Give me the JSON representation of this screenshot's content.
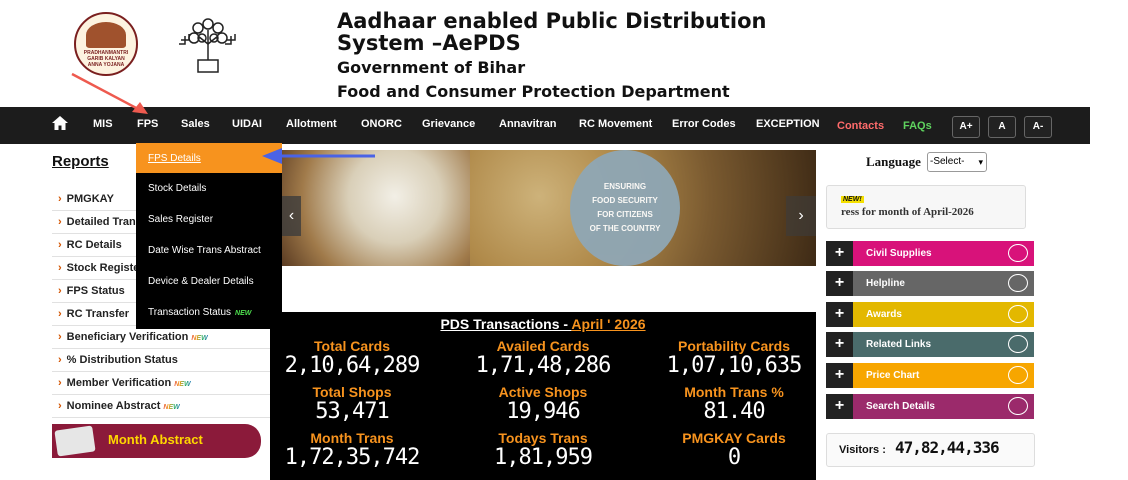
{
  "header": {
    "logo1_text": "PRADHANMANTRI GARIB KALYAN ANNA YOJANA",
    "title_line1": "Aadhaar enabled Public Distribution",
    "title_line2": "System –AePDS",
    "subtitle1": "Government of Bihar",
    "subtitle2": "Food and Consumer Protection Department"
  },
  "nav": {
    "items": [
      "MIS",
      "FPS",
      "Sales",
      "UIDAI",
      "Allotment",
      "ONORC",
      "Grievance",
      "Annavitran",
      "RC Movement",
      "Error Codes",
      "EXCEPTION"
    ],
    "contacts": "Contacts",
    "faqs": "FAQs",
    "font_increase": "A+",
    "font_normal": "A",
    "font_decrease": "A-"
  },
  "dropdown": {
    "items": [
      "FPS Details",
      "Stock Details",
      "Sales Register",
      "Date Wise Trans Abstract",
      "Device & Dealer Details",
      "Transaction Status"
    ],
    "new_badge": "NEW"
  },
  "sidebar": {
    "title": "Reports",
    "items": [
      "PMGKAY",
      "Detailed Tran",
      "RC Details",
      "Stock Registe",
      "FPS Status",
      "RC Transfer",
      "Beneficiary Verification",
      "% Distribution Status",
      "Member Verification",
      "Nominee Abstract"
    ],
    "new_badge": "NEW",
    "month_abstract": "Month Abstract"
  },
  "banner": {
    "text_line1": "ENSURING",
    "text_line2": "FOOD SECURITY",
    "text_line3": "FOR CITIZENS",
    "text_line4": "OF THE COUNTRY"
  },
  "stats": {
    "title_prefix": "PDS Transactions - ",
    "title_month": "April ' 2026",
    "items": [
      {
        "label": "Total Cards",
        "value": "2,10,64,289"
      },
      {
        "label": "Availed Cards",
        "value": "1,71,48,286"
      },
      {
        "label": "Portability Cards",
        "value": "1,07,10,635"
      },
      {
        "label": "Total Shops",
        "value": "53,471"
      },
      {
        "label": "Active Shops",
        "value": "19,946"
      },
      {
        "label": "Month Trans %",
        "value": "81.40"
      },
      {
        "label": "Month Trans",
        "value": "1,72,35,742"
      },
      {
        "label": "Todays Trans",
        "value": "1,81,959"
      },
      {
        "label": "PMGKAY Cards",
        "value": "0"
      }
    ]
  },
  "right": {
    "language_label": "Language",
    "language_selected": "-Select-",
    "news_new": "NEW!",
    "news_text": "ress for month of April-2026",
    "quick_links": [
      {
        "label": "Civil Supplies",
        "color": "#d8127a"
      },
      {
        "label": "Helpline",
        "color": "#666666"
      },
      {
        "label": "Awards",
        "color": "#e3b800"
      },
      {
        "label": "Related Links",
        "color": "#4a6b6b"
      },
      {
        "label": "Price Chart",
        "color": "#f7a600"
      },
      {
        "label": "Search Details",
        "color": "#9b2a6b"
      }
    ],
    "visitors_label": "Visitors :",
    "visitors_count": "47,82,44,336"
  },
  "colors": {
    "nav_bg": "#1c1c1c",
    "accent_orange": "#f7931e",
    "stats_bg": "#000000"
  }
}
